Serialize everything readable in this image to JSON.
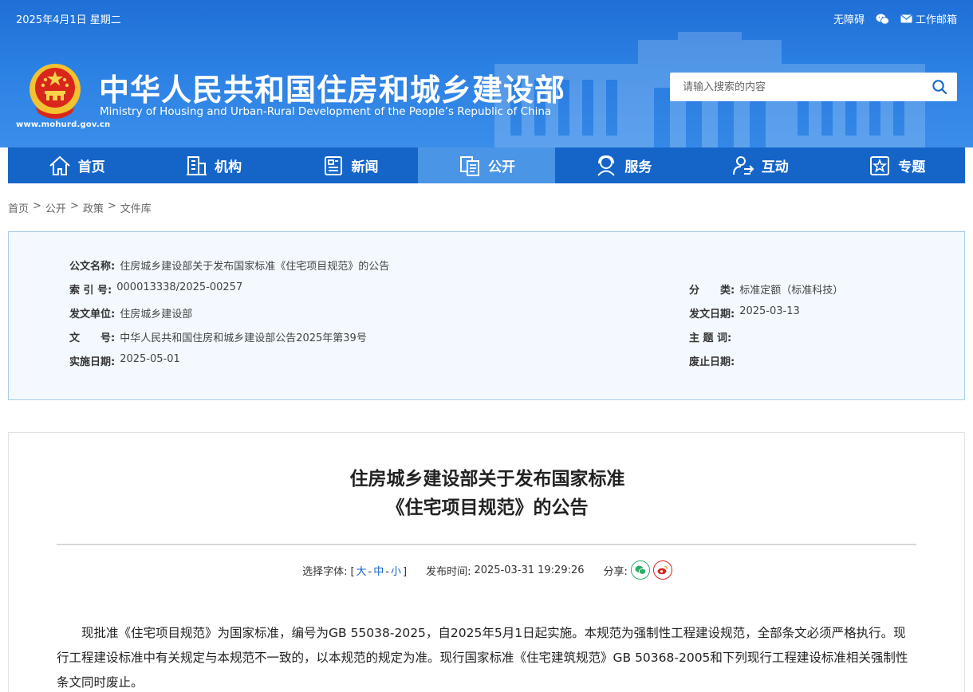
{
  "topbar": {
    "date": "2025年4月1日 星期二",
    "accessibility": "无障碍",
    "mail": "工作邮箱"
  },
  "site": {
    "title_cn": "中华人民共和国住房和城乡建设部",
    "title_en": "Ministry of Housing and Urban-Rural Development of the People’s Republic of China",
    "url": "www.mohurd.gov.cn"
  },
  "search": {
    "placeholder": "请输入搜索的内容"
  },
  "nav": [
    {
      "label": "首页",
      "icon": "home-icon"
    },
    {
      "label": "机构",
      "icon": "building-icon"
    },
    {
      "label": "新闻",
      "icon": "news-icon"
    },
    {
      "label": "公开",
      "icon": "document-icon",
      "active": true
    },
    {
      "label": "服务",
      "icon": "service-icon"
    },
    {
      "label": "互动",
      "icon": "interaction-icon"
    },
    {
      "label": "专题",
      "icon": "star-icon"
    }
  ],
  "breadcrumb": [
    "首页",
    "公开",
    "政策",
    "文件库"
  ],
  "info": {
    "name_label": "公文名称:",
    "name": "住房城乡建设部关于发布国家标准《住宅项目规范》的公告",
    "index_label": "索 引 号:",
    "index": "000013338/2025-00257",
    "category_label": "分　　类:",
    "category": "标准定额（标准科技）",
    "issuer_label": "发文单位:",
    "issuer": "住房城乡建设部",
    "issue_date_label": "发文日期:",
    "issue_date": "2025-03-13",
    "docno_label": "文　　号:",
    "docno": "中华人民共和国住房和城乡建设部公告2025年第39号",
    "subject_label": "主 题 词:",
    "subject": "",
    "effective_label": "实施日期:",
    "effective": "2025-05-01",
    "repeal_label": "废止日期:",
    "repeal": ""
  },
  "article": {
    "title_line1": "住房城乡建设部关于发布国家标准",
    "title_line2": "《住宅项目规范》的公告",
    "font_label": "选择字体:",
    "font_large": "大",
    "font_medium": "中",
    "font_small": "小",
    "publish_label": "发布时间:",
    "publish_time": "2025-03-31 19:29:26",
    "share_label": "分享:",
    "body": "现批准《住宅项目规范》为国家标准，编号为GB 55038-2025，自2025年5月1日起实施。本规范为强制性工程建设规范，全部条文必须严格执行。现行工程建设标准中有关规定与本规范不一致的，以本规范的规定为准。现行国家标准《住宅建筑规范》GB 50368-2005和下列现行工程建设标准相关强制性条文同时废止。"
  }
}
